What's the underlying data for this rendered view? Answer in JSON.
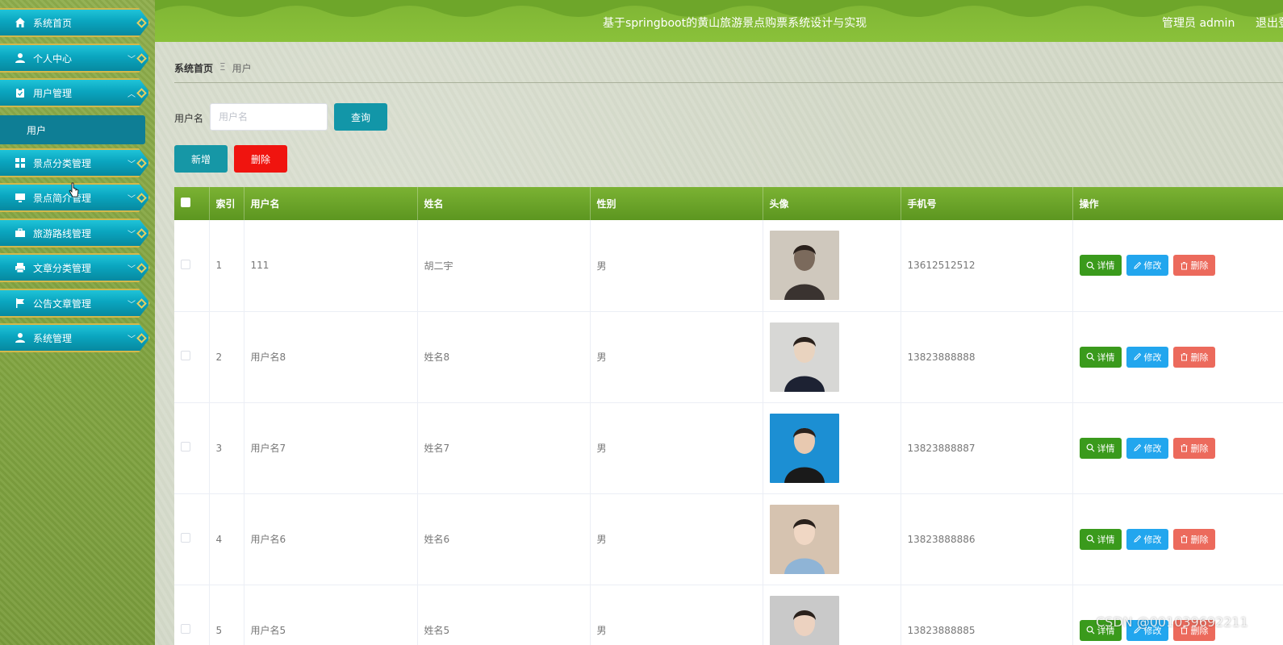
{
  "header": {
    "title": "基于springboot的黄山旅游景点购票系统设计与实现",
    "admin_label": "管理员 admin",
    "logout_label": "退出登录"
  },
  "sidebar": {
    "items": [
      {
        "label": "系统首页",
        "icon": "home-icon"
      },
      {
        "label": "个人中心",
        "icon": "user-icon"
      },
      {
        "label": "用户管理",
        "icon": "clipboard-icon"
      },
      {
        "label": "景点分类管理",
        "icon": "grid-icon"
      },
      {
        "label": "景点简介管理",
        "icon": "monitor-icon"
      },
      {
        "label": "旅游路线管理",
        "icon": "briefcase-icon"
      },
      {
        "label": "文章分类管理",
        "icon": "printer-icon"
      },
      {
        "label": "公告文章管理",
        "icon": "flag-icon"
      },
      {
        "label": "系统管理",
        "icon": "user-icon"
      }
    ],
    "submenu_label": "用户"
  },
  "breadcrumb": {
    "home": "系统首页",
    "separator": "Ξ",
    "current": "用户"
  },
  "search": {
    "label": "用户名",
    "placeholder": "用户名",
    "button": "查询"
  },
  "actions": {
    "add": "新增",
    "delete": "删除"
  },
  "table": {
    "columns": [
      "索引",
      "用户名",
      "姓名",
      "性别",
      "头像",
      "手机号",
      "操作"
    ],
    "rows": [
      {
        "index": "1",
        "username": "111",
        "name": "胡二宇",
        "gender": "男",
        "phone": "13612512512"
      },
      {
        "index": "2",
        "username": "用户名8",
        "name": "姓名8",
        "gender": "男",
        "phone": "13823888888"
      },
      {
        "index": "3",
        "username": "用户名7",
        "name": "姓名7",
        "gender": "男",
        "phone": "13823888887"
      },
      {
        "index": "4",
        "username": "用户名6",
        "name": "姓名6",
        "gender": "男",
        "phone": "13823888886"
      },
      {
        "index": "5",
        "username": "用户名5",
        "name": "姓名5",
        "gender": "男",
        "phone": "13823888885"
      }
    ],
    "ops": {
      "detail": "详情",
      "edit": "修改",
      "delete": "删除"
    }
  },
  "watermark": "CSDN @001039692211",
  "colors": {
    "header": "#8ac13a",
    "menu": "#0aa5bf",
    "detail": "#3a9a1c",
    "edit": "#22a6ee",
    "delete": "#ec6a5c",
    "danger": "#f0140f"
  }
}
